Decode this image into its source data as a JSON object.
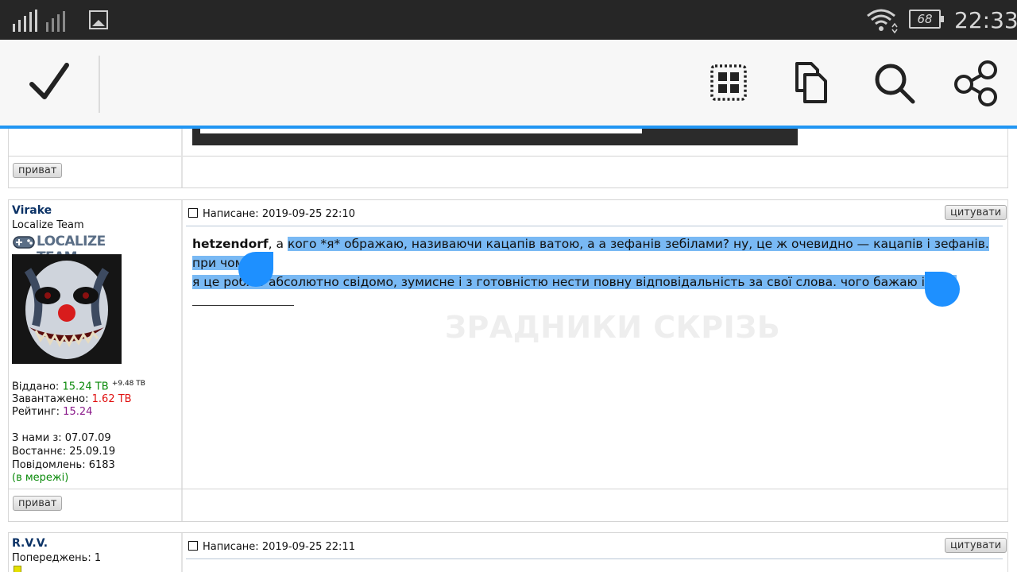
{
  "status_bar": {
    "time": "22:33",
    "battery": "68",
    "icons": [
      "signal-icon",
      "gallery-icon",
      "wifi-icon",
      "battery-icon"
    ]
  },
  "action_bar": {
    "buttons": [
      "done-check-icon",
      "select-all-icon",
      "copy-icon",
      "search-icon",
      "share-icon"
    ],
    "accent_color": "#2196f3"
  },
  "forum": {
    "private_label": "приват",
    "quote_label": "цитувати",
    "posts": [
      {
        "author": {
          "name": "Virake",
          "role": "Localize Team",
          "team_badge": "LOCALIZE TEAM",
          "given_label": "Віддано:",
          "given_value": "15.24 TB",
          "given_delta": "+9.48 TB",
          "downloaded_label": "Завантажено:",
          "downloaded_value": "1.62 TB",
          "rating_label": "Рейтинг:",
          "rating_value": "15.24",
          "joined": "З нами з: 07.07.09",
          "last_seen": "Востаннє: 25.09.19",
          "messages": "Повідомлень: 6183",
          "online": "(в мережі)"
        },
        "written": "Написане: 2019-09-25 22:10",
        "addressee": "hetzendorf",
        "text_prefix": ", а ",
        "selected_text_line1": "кого *я* ображаю, називаючи кацапів ватою, а а зефанів зебілами? ну, це ж очевидно — кацапів і зефанів. при чому,",
        "selected_text_line2": "я це роблю абсолютно свідомо, зумисне і з готовністю нести повну відповідальність за свої слова. чого бажаю і вам.",
        "signature_watermark": "ЗРАДНИКИ СКРІЗЬ"
      },
      {
        "author": {
          "name": "R.V.V.",
          "warnings": "Попереджень: 1"
        },
        "written": "Написане: 2019-09-25 22:11"
      }
    ]
  },
  "colors": {
    "selection": "#79b9f4",
    "handle": "#1e90ff",
    "username": "#0b3266"
  }
}
